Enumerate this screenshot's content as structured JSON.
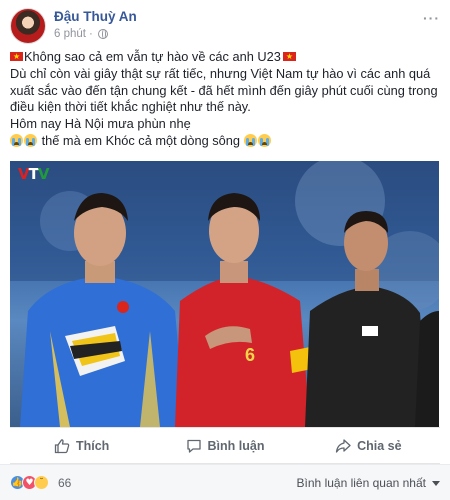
{
  "post": {
    "author": "Đậu Thuỳ An",
    "time": "6 phút",
    "more_icon": "more-dots-icon",
    "lines": [
      "Không sao cả em vẫn tự hào về các anh U23",
      "Dù chỉ còn vài giây thật sự rất tiếc, nhưng Việt Nam tự hào vì các anh quá",
      "xuất sắc vào đến tận chung kết - đã hết mình đến giây phút cuối cùng trong",
      "điều kiện thời tiết khắc nghiệt như thế này.",
      "Hôm nay Hà Nội mưa phùn nhẹ",
      "thế mà em Khóc cả một dòng sông"
    ],
    "photo": {
      "logo_v1": "V",
      "logo_t": "T",
      "logo_v2": "V",
      "jersey_number": "6"
    }
  },
  "actions": {
    "like": "Thích",
    "comment": "Bình luận",
    "share": "Chia sẻ"
  },
  "reactions": {
    "count": "66",
    "sort_label": "Bình luận liên quan nhất"
  },
  "colors": {
    "author": "#365899",
    "flag_red": "#da251d",
    "flag_star": "#ffde00",
    "like_blue": "#4a90e2",
    "love_red": "#f25268"
  }
}
